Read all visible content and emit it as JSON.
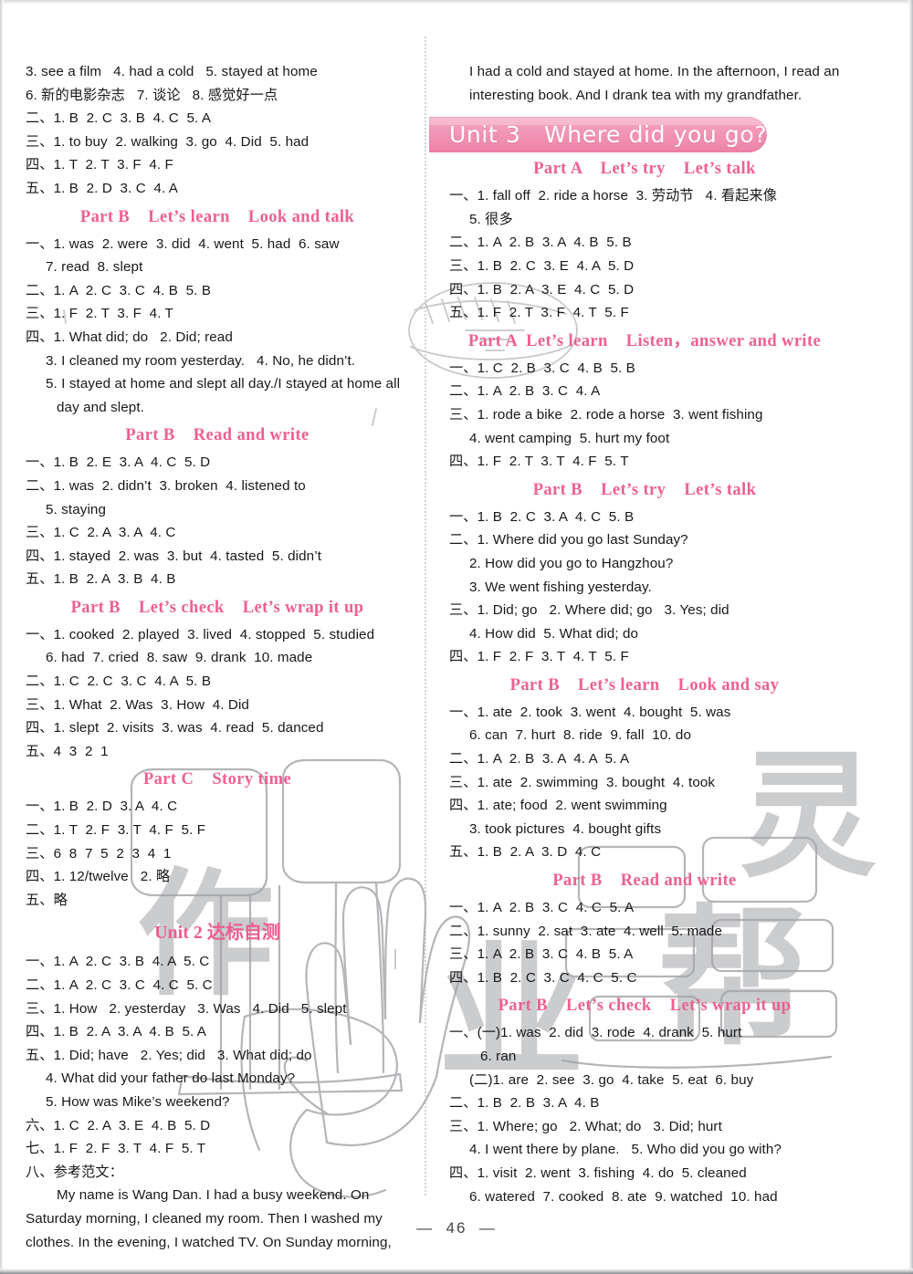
{
  "page": {
    "folio": "—  46  —",
    "accent_pink": "#ef5f92",
    "banner_pink": "#f195b6"
  },
  "banner": {
    "text": "Unit 3   Where did you go?"
  },
  "left_column": [
    {
      "type": "line",
      "text": "3. see a film   4. had a cold   5. stayed at home"
    },
    {
      "type": "line",
      "text": "6. 新的电影杂志   7. 谈论   8. 感觉好一点"
    },
    {
      "type": "line",
      "text": "二、1. B  2. C  3. B  4. C  5. A"
    },
    {
      "type": "line",
      "text": "三、1. to buy  2. walking  3. go  4. Did  5. had"
    },
    {
      "type": "line",
      "text": "四、1. T  2. T  3. F  4. F"
    },
    {
      "type": "line",
      "text": "五、1. B  2. D  3. C  4. A"
    },
    {
      "type": "head",
      "text": "Part B    Let’s learn    Look and talk"
    },
    {
      "type": "line",
      "text": "一、1. was  2. were  3. did  4. went  5. had  6. saw"
    },
    {
      "type": "line",
      "indent": 1,
      "text": "7. read  8. slept"
    },
    {
      "type": "line",
      "text": "二、1. A  2. C  3. C  4. B  5. B"
    },
    {
      "type": "line",
      "text": "三、1. F  2. T  3. F  4. T"
    },
    {
      "type": "line",
      "text": "四、1. What did; do   2. Did; read"
    },
    {
      "type": "line",
      "indent": 1,
      "text": "3. I cleaned my room yesterday.   4. No, he didn’t."
    },
    {
      "type": "line",
      "indent": 1,
      "text": "5. I stayed at home and slept all day./I stayed at home all"
    },
    {
      "type": "line",
      "indent": 2,
      "text": "day and slept."
    },
    {
      "type": "head",
      "text": "Part B    Read and write"
    },
    {
      "type": "line",
      "text": "一、1. B  2. E  3. A  4. C  5. D"
    },
    {
      "type": "line",
      "text": "二、1. was  2. didn’t  3. broken  4. listened to"
    },
    {
      "type": "line",
      "indent": 1,
      "text": "5. staying"
    },
    {
      "type": "line",
      "text": "三、1. C  2. A  3. A  4. C"
    },
    {
      "type": "line",
      "text": "四、1. stayed  2. was  3. but  4. tasted  5. didn’t"
    },
    {
      "type": "line",
      "text": "五、1. B  2. A  3. B  4. B"
    },
    {
      "type": "head",
      "text": "Part B    Let’s check    Let’s wrap it up"
    },
    {
      "type": "line",
      "text": "一、1. cooked  2. played  3. lived  4. stopped  5. studied"
    },
    {
      "type": "line",
      "indent": 1,
      "text": "6. had  7. cried  8. saw  9. drank  10. made"
    },
    {
      "type": "line",
      "text": "二、1. C  2. C  3. C  4. A  5. B"
    },
    {
      "type": "line",
      "text": "三、1. What  2. Was  3. How  4. Did"
    },
    {
      "type": "line",
      "text": "四、1. slept  2. visits  3. was  4. read  5. danced"
    },
    {
      "type": "line",
      "text": "五、4  3  2  1"
    },
    {
      "type": "head",
      "text": "Part C    Story time"
    },
    {
      "type": "line",
      "text": "一、1. B  2. D  3. A  4. C"
    },
    {
      "type": "line",
      "text": "二、1. T  2. F  3. T  4. F  5. F"
    },
    {
      "type": "line",
      "text": "三、6  8  7  5  2  3  4  1"
    },
    {
      "type": "line",
      "text": "四、1. 12/twelve   2. 略"
    },
    {
      "type": "line",
      "text": "五、略"
    },
    {
      "type": "unit",
      "text": "Unit 2 达标自测"
    },
    {
      "type": "line",
      "text": "一、1. A  2. C  3. B  4. A  5. C"
    },
    {
      "type": "line",
      "text": "二、1. A  2. C  3. C  4. C  5. C"
    },
    {
      "type": "line",
      "text": "三、1. How   2. yesterday   3. Was   4. Did   5. slept"
    },
    {
      "type": "line",
      "text": "四、1. B  2. A  3. A  4. B  5. A"
    },
    {
      "type": "line",
      "text": "五、1. Did; have   2. Yes; did   3. What did; do"
    },
    {
      "type": "line",
      "indent": 1,
      "text": "4. What did your father do last Monday?"
    },
    {
      "type": "line",
      "indent": 1,
      "text": "5. How was Mike’s weekend?"
    },
    {
      "type": "line",
      "text": "六、1. C  2. A  3. E  4. B  5. D"
    },
    {
      "type": "line",
      "text": "七、1. F  2. F  3. T  4. F  5. T"
    },
    {
      "type": "line",
      "text": "八、参考范文："
    },
    {
      "type": "line",
      "indent": 2,
      "text": "My name is Wang Dan. I had a busy weekend. On"
    },
    {
      "type": "line",
      "text": "Saturday morning, I cleaned my room. Then I washed my"
    },
    {
      "type": "line",
      "text": "clothes. In the evening, I watched TV. On Sunday morning,"
    }
  ],
  "right_column": [
    {
      "type": "line",
      "indent": 1,
      "text": "I had a cold and stayed at home. In the afternoon, I read an"
    },
    {
      "type": "line",
      "indent": 1,
      "text": "interesting book. And I drank tea with my grandfather."
    },
    {
      "type": "banner-space"
    },
    {
      "type": "head",
      "text": "Part A    Let’s try    Let’s talk"
    },
    {
      "type": "line",
      "text": "一、1. fall off  2. ride a horse  3. 劳动节   4. 看起来像"
    },
    {
      "type": "line",
      "indent": 1,
      "text": "5. 很多"
    },
    {
      "type": "line",
      "text": "二、1. A  2. B  3. A  4. B  5. B"
    },
    {
      "type": "line",
      "text": "三、1. B  2. C  3. E  4. A  5. D"
    },
    {
      "type": "line",
      "text": "四、1. B  2. A  3. E  4. C  5. D"
    },
    {
      "type": "line",
      "text": "五、1. F  2. T  3. F  4. T  5. F"
    },
    {
      "type": "head",
      "text": "Part A  Let’s learn    Listen，answer and write"
    },
    {
      "type": "line",
      "text": "一、1. C  2. B  3. C  4. B  5. B"
    },
    {
      "type": "line",
      "text": "二、1. A  2. B  3. C  4. A"
    },
    {
      "type": "line",
      "text": "三、1. rode a bike  2. rode a horse  3. went fishing"
    },
    {
      "type": "line",
      "indent": 1,
      "text": "4. went camping  5. hurt my foot"
    },
    {
      "type": "line",
      "text": "四、1. F  2. T  3. T  4. F  5. T"
    },
    {
      "type": "head",
      "text": "Part B    Let’s try    Let’s talk"
    },
    {
      "type": "line",
      "text": "一、1. B  2. C  3. A  4. C  5. B"
    },
    {
      "type": "line",
      "text": "二、1. Where did you go last Sunday?"
    },
    {
      "type": "line",
      "indent": 1,
      "text": "2. How did you go to Hangzhou?"
    },
    {
      "type": "line",
      "indent": 1,
      "text": "3. We went fishing yesterday."
    },
    {
      "type": "line",
      "text": "三、1. Did; go   2. Where did; go   3. Yes; did"
    },
    {
      "type": "line",
      "indent": 1,
      "text": "4. How did  5. What did; do"
    },
    {
      "type": "line",
      "text": "四、1. F  2. F  3. T  4. T  5. F"
    },
    {
      "type": "head",
      "text": "Part B    Let’s learn    Look and say"
    },
    {
      "type": "line",
      "text": "一、1. ate  2. took  3. went  4. bought  5. was"
    },
    {
      "type": "line",
      "indent": 1,
      "text": "6. can  7. hurt  8. ride  9. fall  10. do"
    },
    {
      "type": "line",
      "text": "二、1. A  2. B  3. A  4. A  5. A"
    },
    {
      "type": "line",
      "text": "三、1. ate  2. swimming  3. bought  4. took"
    },
    {
      "type": "line",
      "text": "四、1. ate; food  2. went swimming"
    },
    {
      "type": "line",
      "indent": 1,
      "text": "3. took pictures  4. bought gifts"
    },
    {
      "type": "line",
      "text": "五、1. B  2. A  3. D  4. C"
    },
    {
      "type": "head",
      "text": "Part B    Read and write"
    },
    {
      "type": "line",
      "text": "一、1. A  2. B  3. C  4. C  5. A"
    },
    {
      "type": "line",
      "text": "二、1. sunny  2. sat  3. ate  4. well  5. made"
    },
    {
      "type": "line",
      "text": "三、1. A  2. B  3. C  4. B  5. A"
    },
    {
      "type": "line",
      "text": "四、1. B  2. C  3. C  4. C  5. C"
    },
    {
      "type": "head",
      "text": "Part B    Let’s check    Let’s wrap it up"
    },
    {
      "type": "line",
      "text": "一、(一)1. was  2. did  3. rode  4. drank  5. hurt"
    },
    {
      "type": "line",
      "indent": 2,
      "text": "6. ran"
    },
    {
      "type": "line",
      "indent": 1,
      "text": "(二)1. are  2. see  3. go  4. take  5. eat  6. buy"
    },
    {
      "type": "line",
      "text": "二、1. B  2. B  3. A  4. B"
    },
    {
      "type": "line",
      "text": "三、1. Where; go   2. What; do   3. Did; hurt"
    },
    {
      "type": "line",
      "indent": 1,
      "text": "4. I went there by plane.   5. Who did you go with?"
    },
    {
      "type": "line",
      "text": "四、1. visit  2. went  3. fishing  4. do  5. cleaned"
    },
    {
      "type": "line",
      "indent": 1,
      "text": "6. watered  7. cooked  8. ate  9. watched  10. had"
    }
  ]
}
